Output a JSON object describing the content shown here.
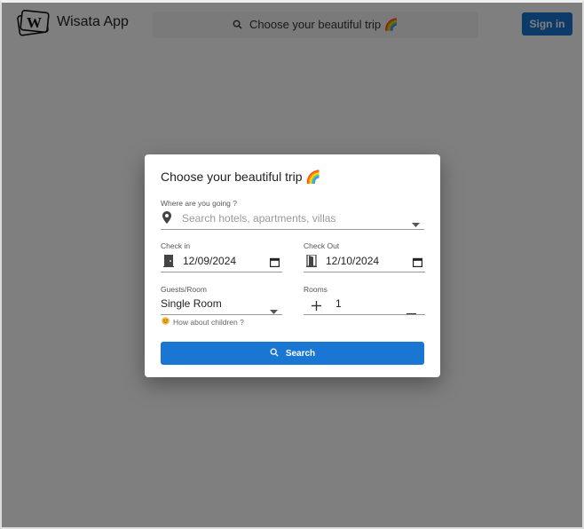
{
  "header": {
    "app_name": "Wisata App",
    "search_text": "Choose your beautiful trip 🌈",
    "signin_label": "Sign in"
  },
  "dialog": {
    "title": "Choose your beautiful trip 🌈",
    "destination": {
      "label": "Where are you going ?",
      "placeholder": "Search hotels, apartments, villas"
    },
    "check_in": {
      "label": "Check in",
      "value": "12/09/2024"
    },
    "check_out": {
      "label": "Check Out",
      "value": "12/10/2024"
    },
    "guests": {
      "label": "Guests/Room",
      "value": "Single Room"
    },
    "rooms": {
      "label": "Rooms",
      "value": "1"
    },
    "children_hint": "How about children ?",
    "search_label": "Search"
  },
  "colors": {
    "primary": "#1976d2",
    "overlay": "rgba(0,0,0,0.5)"
  }
}
